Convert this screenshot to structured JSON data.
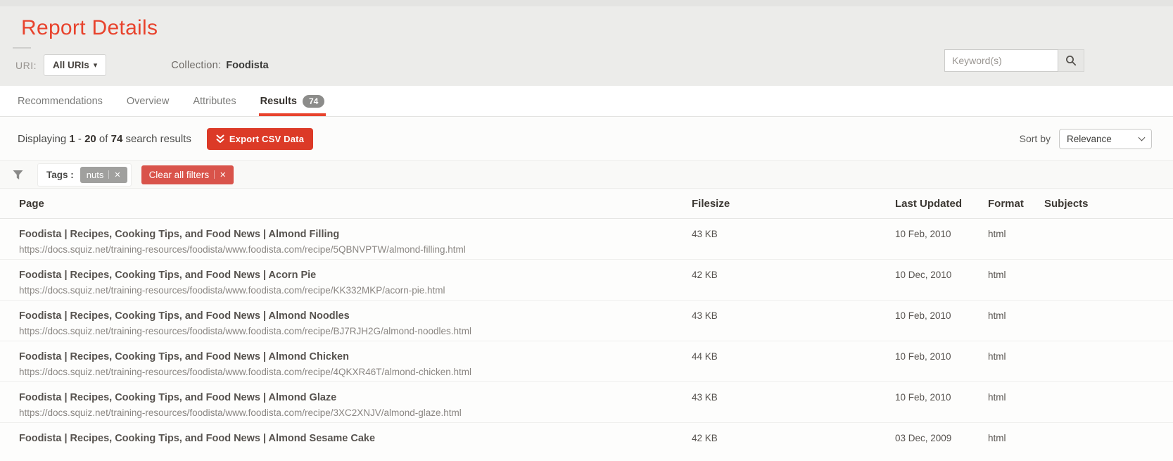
{
  "page": {
    "title": "Report Details"
  },
  "header": {
    "uri_label": "URI:",
    "uri_button_label": "All URIs",
    "collection_label": "Collection:",
    "collection_value": "Foodista",
    "search_placeholder": "Keyword(s)"
  },
  "tabs": [
    {
      "label": "Recommendations",
      "active": false
    },
    {
      "label": "Overview",
      "active": false
    },
    {
      "label": "Attributes",
      "active": false
    },
    {
      "label": "Results",
      "active": true,
      "badge": "74"
    }
  ],
  "results_bar": {
    "displaying_word": "Displaying",
    "range_start": "1",
    "range_separator": "-",
    "range_end": "20",
    "of_word": "of",
    "total": "74",
    "suffix": "search results",
    "export_button_label": "Export CSV Data",
    "sort_by_label": "Sort by",
    "sort_selected": "Relevance"
  },
  "filters": {
    "tags_label": "Tags :",
    "tag_value": "nuts",
    "clear_all_label": "Clear all filters"
  },
  "icons": {
    "close": "✕",
    "caret_down": "▾"
  },
  "colors": {
    "accent_red": "#e8432d",
    "export_button_red": "#dc3a27",
    "clear_filter_red": "#d9534a",
    "tag_pill_gray": "#a0a09e",
    "badge_gray": "#8c8c8a",
    "header_gray": "#ececea"
  },
  "table": {
    "columns": [
      "Page",
      "Filesize",
      "Last Updated",
      "Format",
      "Subjects"
    ],
    "rows": [
      {
        "title": "Foodista | Recipes, Cooking Tips, and Food News | Almond Filling",
        "url": "https://docs.squiz.net/training-resources/foodista/www.foodista.com/recipe/5QBNVPTW/almond-filling.html",
        "filesize": "43 KB",
        "updated": "10 Feb, 2010",
        "format": "html",
        "subjects": ""
      },
      {
        "title": "Foodista | Recipes, Cooking Tips, and Food News | Acorn Pie",
        "url": "https://docs.squiz.net/training-resources/foodista/www.foodista.com/recipe/KK332MKP/acorn-pie.html",
        "filesize": "42 KB",
        "updated": "10 Dec, 2010",
        "format": "html",
        "subjects": ""
      },
      {
        "title": "Foodista | Recipes, Cooking Tips, and Food News | Almond Noodles",
        "url": "https://docs.squiz.net/training-resources/foodista/www.foodista.com/recipe/BJ7RJH2G/almond-noodles.html",
        "filesize": "43 KB",
        "updated": "10 Feb, 2010",
        "format": "html",
        "subjects": ""
      },
      {
        "title": "Foodista | Recipes, Cooking Tips, and Food News | Almond Chicken",
        "url": "https://docs.squiz.net/training-resources/foodista/www.foodista.com/recipe/4QKXR46T/almond-chicken.html",
        "filesize": "44 KB",
        "updated": "10 Feb, 2010",
        "format": "html",
        "subjects": ""
      },
      {
        "title": "Foodista | Recipes, Cooking Tips, and Food News | Almond Glaze",
        "url": "https://docs.squiz.net/training-resources/foodista/www.foodista.com/recipe/3XC2XNJV/almond-glaze.html",
        "filesize": "43 KB",
        "updated": "10 Feb, 2010",
        "format": "html",
        "subjects": ""
      },
      {
        "title": "Foodista | Recipes, Cooking Tips, and Food News | Almond Sesame Cake",
        "url": "",
        "filesize": "42 KB",
        "updated": "03 Dec, 2009",
        "format": "html",
        "subjects": ""
      }
    ]
  }
}
